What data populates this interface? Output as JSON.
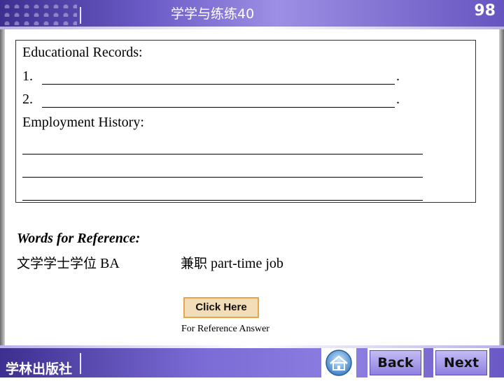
{
  "header": {
    "title": "学学与练练40",
    "page_number": "98"
  },
  "form": {
    "educational_label": "Educational Records:",
    "item1_number": "1.",
    "item2_number": "2.",
    "period": ".",
    "employment_label": "Employment History:"
  },
  "reference": {
    "heading": "Words for Reference:",
    "item1_cn": "文学学士学位",
    "item1_en": " BA",
    "item2_cn": "兼职",
    "item2_en": " part-time job"
  },
  "answer": {
    "button_label": "Click Here",
    "caption": "For Reference Answer"
  },
  "footer": {
    "publisher": "学林出版社",
    "home_icon": "home-icon",
    "back_label": "Back",
    "next_label": "Next"
  },
  "colors": {
    "banner": "#6c5cc8",
    "click_button_bg": "#f3ddb8",
    "click_button_border": "#e6a74a"
  }
}
